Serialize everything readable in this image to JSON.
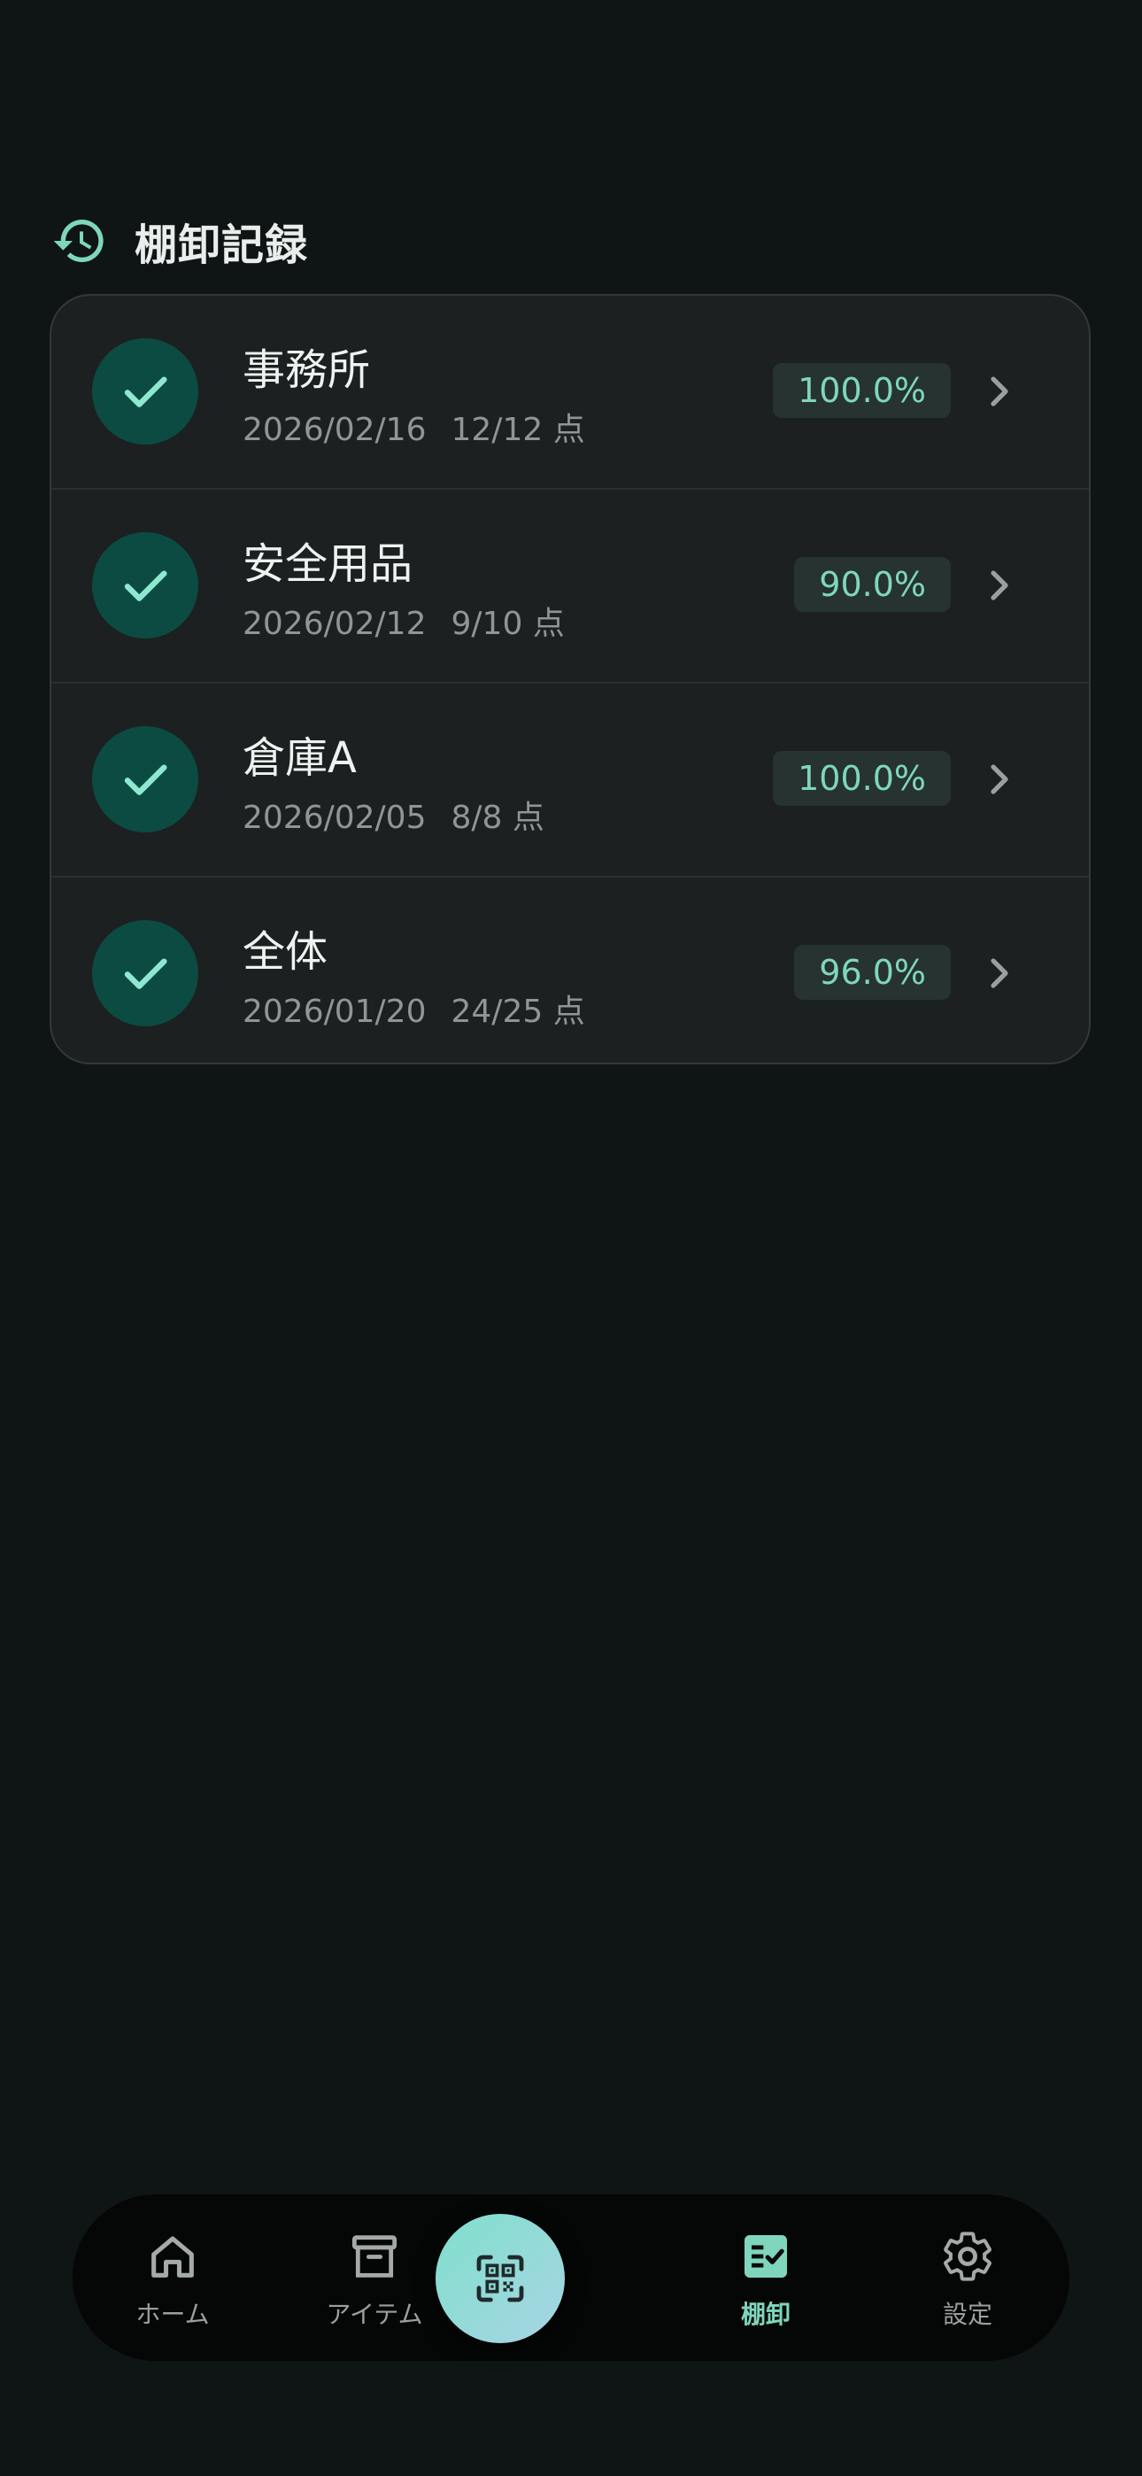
{
  "section": {
    "title": "棚卸記録",
    "icon": "history-icon"
  },
  "records": [
    {
      "name": "事務所",
      "date": "2026/02/16",
      "count": "12/12 点",
      "percent": "100.0%"
    },
    {
      "name": "安全用品",
      "date": "2026/02/12",
      "count": "9/10 点",
      "percent": "90.0%"
    },
    {
      "name": "倉庫A",
      "date": "2026/02/05",
      "count": "8/8 点",
      "percent": "100.0%"
    },
    {
      "name": "全体",
      "date": "2026/01/20",
      "count": "24/25 点",
      "percent": "96.0%"
    }
  ],
  "bottom_nav": {
    "items": [
      {
        "label": "ホーム",
        "icon": "home-icon",
        "active": false
      },
      {
        "label": "アイテム",
        "icon": "archive-box-icon",
        "active": false
      },
      {
        "label": "棚卸",
        "icon": "checklist-icon",
        "active": true
      },
      {
        "label": "設定",
        "icon": "gear-icon",
        "active": false
      }
    ],
    "center_action": {
      "icon": "qr-scan-icon"
    }
  },
  "colors": {
    "background": "#0f1514",
    "card": "#1c2020",
    "accent": "#7fd6bd",
    "check_circle": "#0c4b42",
    "badge_bg": "#263330"
  }
}
